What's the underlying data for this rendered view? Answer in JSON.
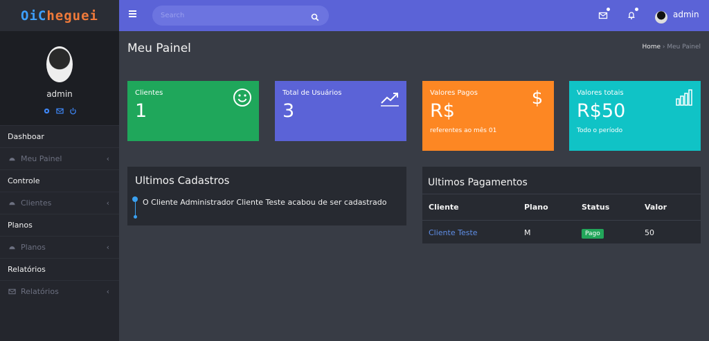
{
  "app": {
    "logo_prefix": "Oi",
    "logo_mid": "C",
    "logo_suffix": "hegue"
  },
  "sidebar": {
    "user_name": "admin",
    "sections": [
      {
        "header": "Dashboar",
        "item": "Meu Painel"
      },
      {
        "header": "Controle",
        "item": "Clientes"
      },
      {
        "header": "Planos",
        "item": "Planos"
      },
      {
        "header": "Relatórios",
        "item": "Relatórios"
      }
    ]
  },
  "topbar": {
    "search_placeholder": "Search",
    "user_name": "admin"
  },
  "page": {
    "title": "Meu Painel",
    "breadcrumb_home": "Home",
    "breadcrumb_sep": " › ",
    "breadcrumb_current": "Meu Painel"
  },
  "cards": [
    {
      "label": "Clientes",
      "value": "1",
      "sub": "",
      "color": "#1fa75b",
      "icon": "smiley-icon"
    },
    {
      "label": "Total de Usuários",
      "value": "3",
      "sub": "",
      "color": "#5b63d7",
      "icon": "trend-up-icon"
    },
    {
      "label": "Valores Pagos",
      "value": "R$",
      "sub": "referentes ao mês 01",
      "color": "#fd8723",
      "icon": "dollar-icon"
    },
    {
      "label": "Valores totais",
      "value": "R$50",
      "sub": "Todo o período",
      "color": "#10c3c6",
      "icon": "bar-chart-icon"
    }
  ],
  "ultimos_cadastros": {
    "title": "Ultimos Cadastros",
    "entries": [
      "O Cliente Administrador Cliente Teste acabou de ser cadastrado"
    ]
  },
  "ultimos_pagamentos": {
    "title": "Ultimos Pagamentos",
    "columns": [
      "Cliente",
      "Plano",
      "Status",
      "Valor"
    ],
    "rows": [
      {
        "cliente": "Cliente Teste",
        "plano": "M",
        "status": "Pago",
        "valor": "50"
      }
    ]
  }
}
